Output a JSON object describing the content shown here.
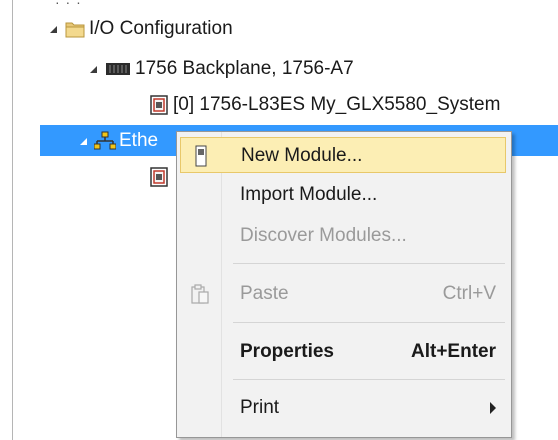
{
  "tree": {
    "top_fragment": "· · ·",
    "io_configuration": "I/O Configuration",
    "backplane": "1756 Backplane, 1756-A7",
    "controller": "[0] 1756-L83ES My_GLX5580_System",
    "ethernet_partial": "Ethe"
  },
  "context_menu": {
    "new_module": "New Module...",
    "import_module": "Import Module...",
    "discover_modules": "Discover Modules...",
    "paste": "Paste",
    "paste_shortcut": "Ctrl+V",
    "properties": "Properties",
    "properties_shortcut": "Alt+Enter",
    "print": "Print"
  },
  "colors": {
    "selection": "#3399ff",
    "menu_highlight": "#fceeb4",
    "menu_background": "#f2f2f2",
    "disabled_text": "#9a9a9a"
  }
}
